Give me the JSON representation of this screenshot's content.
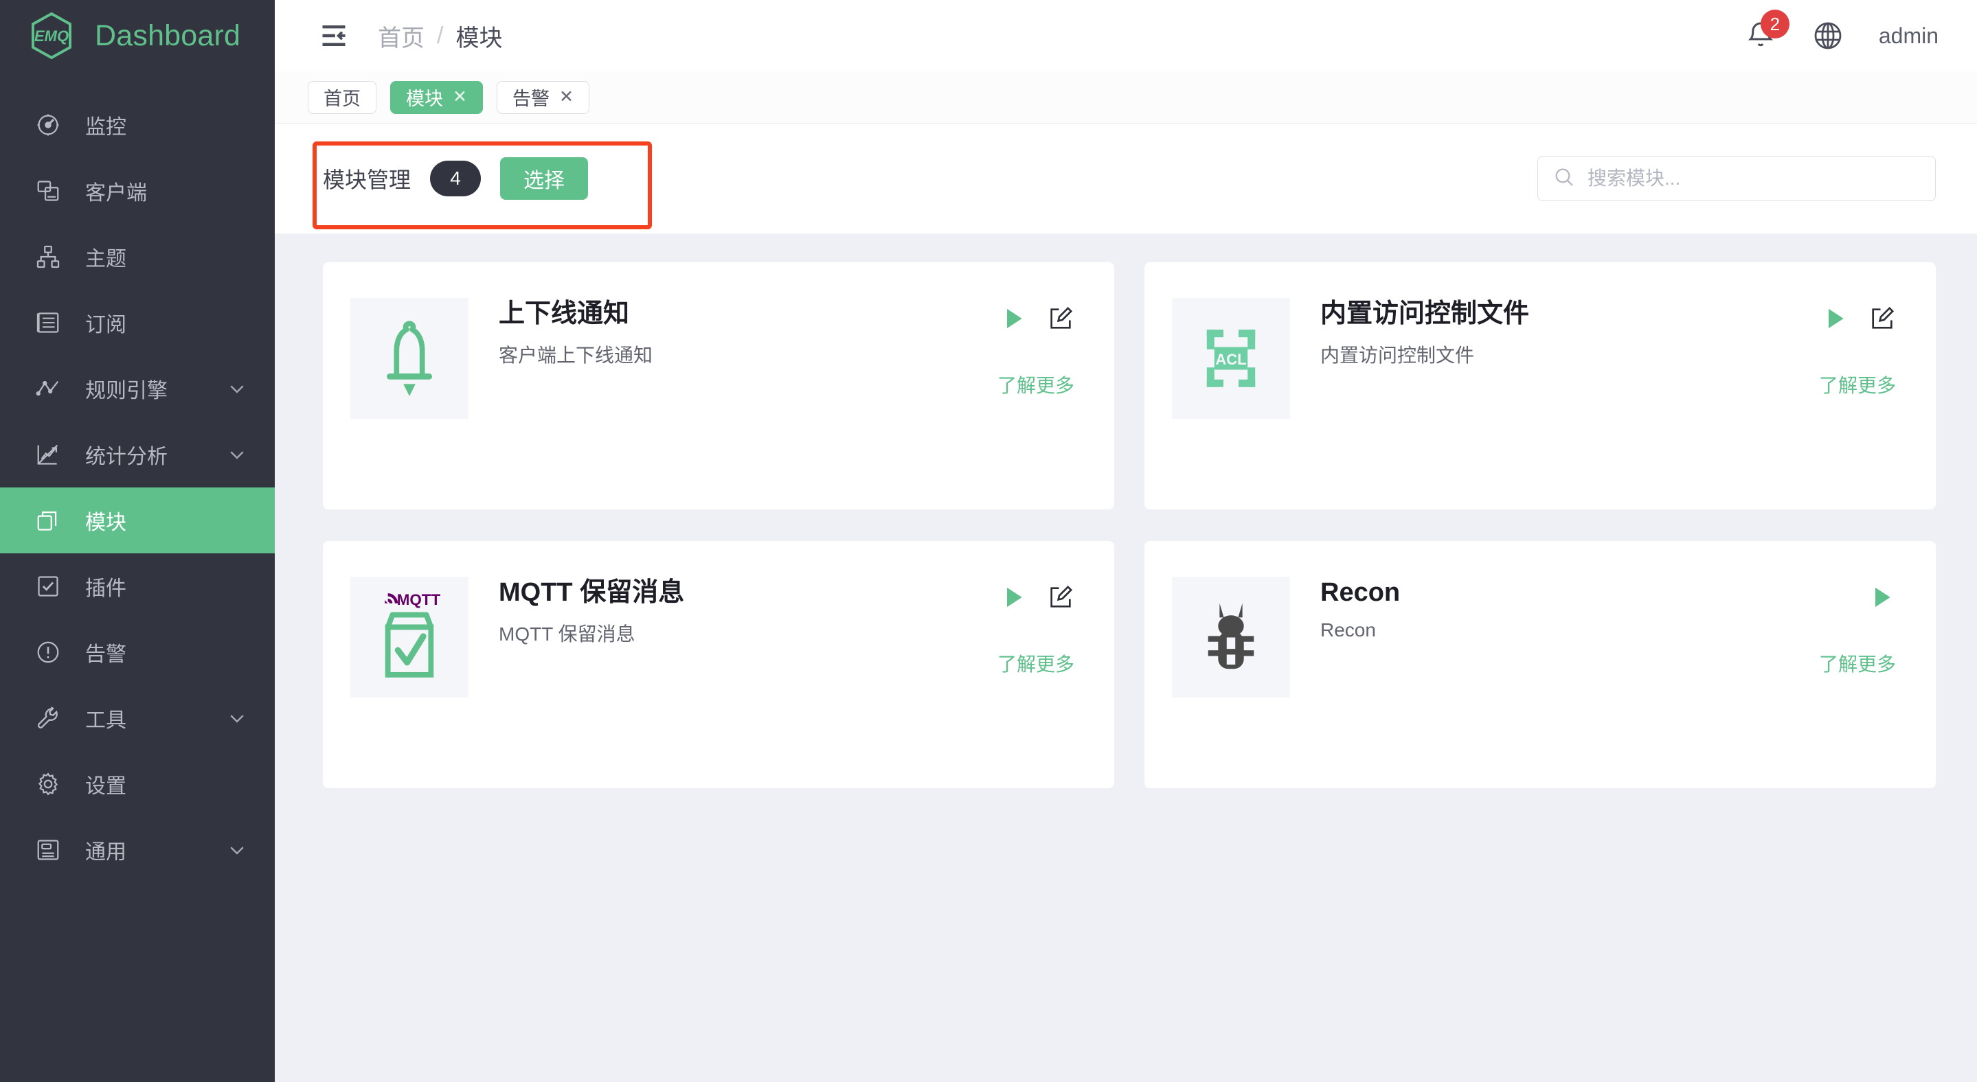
{
  "brand": {
    "logo_text": "EMQ",
    "title": "Dashboard"
  },
  "sidebar": {
    "items": [
      {
        "label": "监控",
        "icon": "gauge-icon",
        "has_arrow": false,
        "active": false
      },
      {
        "label": "客户端",
        "icon": "clients-icon",
        "has_arrow": false,
        "active": false
      },
      {
        "label": "主题",
        "icon": "topic-tree-icon",
        "has_arrow": false,
        "active": false
      },
      {
        "label": "订阅",
        "icon": "list-icon",
        "has_arrow": false,
        "active": false
      },
      {
        "label": "规则引擎",
        "icon": "nodes-icon",
        "has_arrow": true,
        "active": false
      },
      {
        "label": "统计分析",
        "icon": "chart-icon",
        "has_arrow": true,
        "active": false
      },
      {
        "label": "模块",
        "icon": "modules-icon",
        "has_arrow": false,
        "active": true
      },
      {
        "label": "插件",
        "icon": "checkbox-icon",
        "has_arrow": false,
        "active": false
      },
      {
        "label": "告警",
        "icon": "alert-icon",
        "has_arrow": false,
        "active": false
      },
      {
        "label": "工具",
        "icon": "wrench-icon",
        "has_arrow": true,
        "active": false
      },
      {
        "label": "设置",
        "icon": "gear-icon",
        "has_arrow": false,
        "active": false
      },
      {
        "label": "通用",
        "icon": "general-icon",
        "has_arrow": true,
        "active": false
      }
    ]
  },
  "topbar": {
    "fold_icon": "menu-fold-icon",
    "breadcrumb": {
      "parent": "首页",
      "separator": "/",
      "current": "模块"
    },
    "notifications": {
      "icon": "bell-icon",
      "count": "2",
      "badge_color": "#e04040"
    },
    "language_icon": "globe-icon",
    "user": "admin"
  },
  "tabs": [
    {
      "label": "首页",
      "closable": false,
      "active": false
    },
    {
      "label": "模块",
      "closable": true,
      "active": true
    },
    {
      "label": "告警",
      "closable": true,
      "active": false
    }
  ],
  "toolbar": {
    "title": "模块管理",
    "count": "4",
    "select_label": "选择",
    "search_placeholder": "搜索模块...",
    "search_value": "",
    "search_icon": "search-icon",
    "annotation_color": "#f4411e"
  },
  "cards": [
    {
      "title": "上下线通知",
      "desc": "客户端上下线通知",
      "icon": "bell-module-icon",
      "more_label": "了解更多",
      "has_play": true,
      "has_edit": true
    },
    {
      "title": "内置访问控制文件",
      "desc": "内置访问控制文件",
      "icon": "acl-module-icon",
      "icon_text": "ACL",
      "more_label": "了解更多",
      "has_play": true,
      "has_edit": true
    },
    {
      "title": "MQTT 保留消息",
      "desc": "MQTT 保留消息",
      "icon": "mqtt-retain-module-icon",
      "icon_text": "MQTT",
      "more_label": "了解更多",
      "has_play": true,
      "has_edit": true
    },
    {
      "title": "Recon",
      "desc": "Recon",
      "icon": "bug-module-icon",
      "more_label": "了解更多",
      "has_play": true,
      "has_edit": false
    }
  ],
  "colors": {
    "accent_green": "#5fc08c",
    "sidebar_dark": "#32343f",
    "page_bg": "#eff0f5",
    "badge_red": "#e04040",
    "annotation_red": "#f4411e",
    "mqtt_purple": "#660066"
  }
}
